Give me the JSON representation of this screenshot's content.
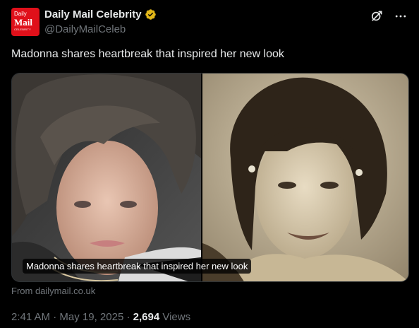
{
  "account": {
    "avatar_line1": "Daily",
    "avatar_line2": "Mail",
    "avatar_line3": "CELEBRITY",
    "display_name": "Daily Mail Celebrity",
    "handle": "@DailyMailCeleb",
    "verified_color": "#e2b719",
    "avatar_color": "#e0101a"
  },
  "icons": {
    "grok": "grok-icon",
    "more": "more-icon"
  },
  "tweet": {
    "text": "Madonna shares heartbreak that inspired her new look"
  },
  "media": {
    "caption": "Madonna shares heartbreak that inspired her new look",
    "left_image": "color portrait of woman with curly dark hair",
    "right_image": "sepia vintage portrait of smiling woman"
  },
  "link": {
    "source": "From dailymail.co.uk"
  },
  "meta": {
    "time": "2:41 AM",
    "separator": "·",
    "date": "May 19, 2025",
    "views_count": "2,694",
    "views_label": "Views"
  }
}
